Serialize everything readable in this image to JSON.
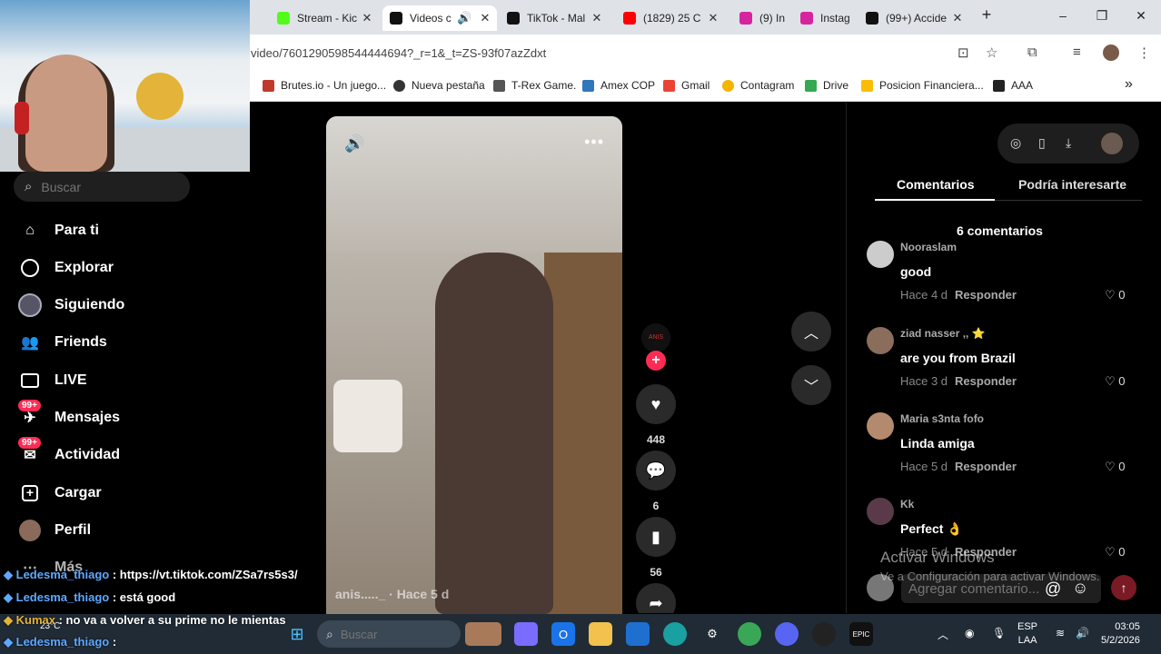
{
  "tabs": [
    {
      "label": "Stream - Kic",
      "color": "#53fc18"
    },
    {
      "label": "Videos c",
      "color": "#111111",
      "active": true
    },
    {
      "label": "TikTok - Mal",
      "color": "#111111"
    },
    {
      "label": "(1829) 25 C",
      "color": "#ff0000"
    },
    {
      "label": "(9) In",
      "color": "#d6249f"
    },
    {
      "label": "Instag",
      "color": "#d6249f"
    },
    {
      "label": "(99+) Accide",
      "color": "#111111"
    }
  ],
  "window_controls": {
    "minimize": "–",
    "maximize": "❐",
    "close": "✕"
  },
  "new_tab": "+",
  "address": {
    "url": "video/7601290598544444694?_r=1&_t=ZS-93f07azZdxt"
  },
  "bookmarks": [
    {
      "label": "Brutes.io - Un juego...",
      "color": "#c0392b"
    },
    {
      "label": "Nueva pestaña",
      "color": "#333333"
    },
    {
      "label": "T-Rex Game.",
      "color": "#555555"
    },
    {
      "label": "Amex COP",
      "color": "#2e77bb"
    },
    {
      "label": "Gmail",
      "color": "#ea4335"
    },
    {
      "label": "Contagram",
      "color": "#f4b400"
    },
    {
      "label": "Drive",
      "color": "#34a853"
    },
    {
      "label": "Posicion Financiera...",
      "color": "#fbbc05"
    },
    {
      "label": "AAA",
      "color": "#222222"
    }
  ],
  "bookmarks_more": "»",
  "search": {
    "placeholder": "Buscar"
  },
  "nav": [
    {
      "label": "Para ti",
      "icon": "home-icon"
    },
    {
      "label": "Explorar",
      "icon": "compass-icon"
    },
    {
      "label": "Siguiendo",
      "icon": "following-avatar-icon"
    },
    {
      "label": "Friends",
      "icon": "friends-icon"
    },
    {
      "label": "LIVE",
      "icon": "live-tv-icon"
    },
    {
      "label": "Mensajes",
      "icon": "messages-icon",
      "badge": "99+"
    },
    {
      "label": "Actividad",
      "icon": "activity-icon",
      "badge": "99+"
    },
    {
      "label": "Cargar",
      "icon": "upload-icon"
    },
    {
      "label": "Perfil",
      "icon": "profile-avatar-icon"
    },
    {
      "label": "Más",
      "icon": "more-dots-icon"
    }
  ],
  "chat": [
    {
      "user": "Ledesma_thiago",
      "message": ": https://vt.tiktok.com/ZSa7rs5s3/"
    },
    {
      "user": "Ledesma_thiago",
      "message": ": está good"
    },
    {
      "user": "Kumax",
      "message": ": no va a volver a su prime no le mientas"
    },
    {
      "user": "Ledesma_thiago",
      "message": ":"
    }
  ],
  "video": {
    "caption": "anis....._ · Hace 5 d",
    "avatar_label": "ANIS"
  },
  "actions": {
    "likes": "448",
    "comments": "6",
    "saves": "56"
  },
  "right_panel": {
    "tabs": [
      "Comentarios",
      "Podría interesarte"
    ],
    "count_label": "6 comentarios",
    "comments": [
      {
        "name": "Nooraslam",
        "text": "good",
        "time": "Hace 4 d",
        "reply": "Responder",
        "likes": "0",
        "avatar_color": "#cccccc"
      },
      {
        "name": "ziad nasser ,, ⭐",
        "text": "are you from Brazil",
        "time": "Hace 3 d",
        "reply": "Responder",
        "likes": "0",
        "avatar_color": "#8a6d5a"
      },
      {
        "name": "Maria s3nta fofo",
        "text": "Linda amiga",
        "time": "Hace 5 d",
        "reply": "Responder",
        "likes": "0",
        "avatar_color": "#b48a6e"
      },
      {
        "name": "Kk",
        "text": "Perfect 👌",
        "time": "Hace 5 d",
        "reply": "Responder",
        "likes": "0",
        "avatar_color": "#5a3a4a"
      }
    ],
    "compose_placeholder": "Agregar comentario...",
    "activate_title": "Activar Windows",
    "activate_sub": "Ve a Configuración para activar Windows."
  },
  "taskbar": {
    "temp": "23°C",
    "search_placeholder": "Buscar",
    "lang_top": "ESP",
    "lang_bottom": "LAA",
    "time": "03:05",
    "date": "5/2/2026"
  }
}
